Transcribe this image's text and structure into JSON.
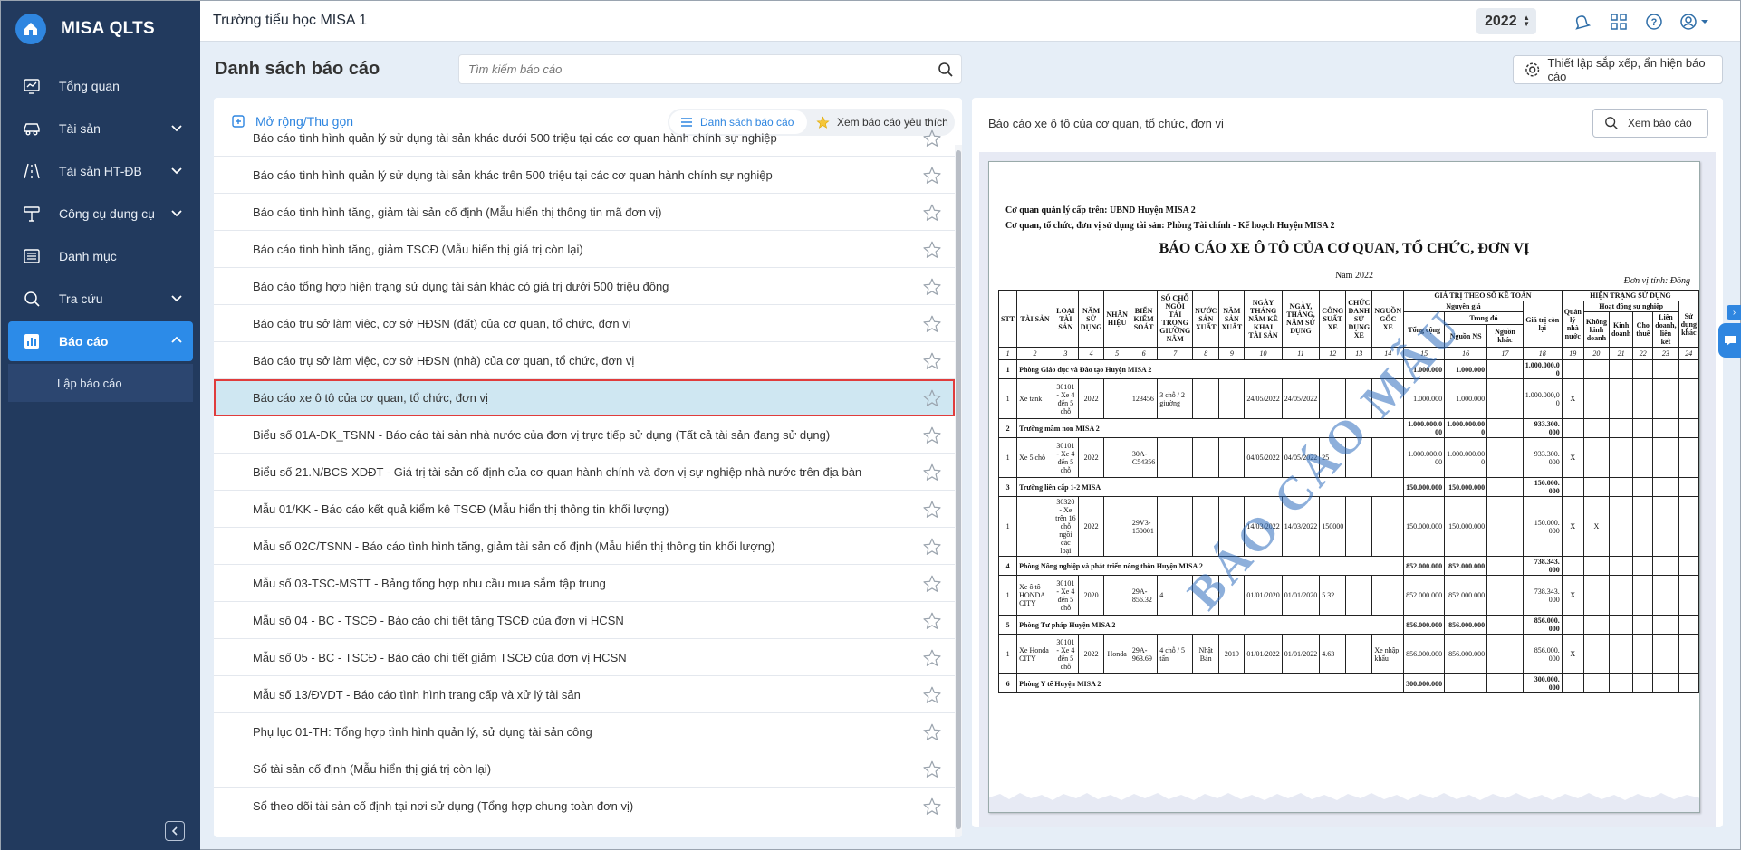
{
  "app": {
    "name": "MISA QLTS"
  },
  "sidebar": {
    "items": [
      {
        "label": "Tổng quan",
        "icon": "dashboard-icon",
        "expandable": false
      },
      {
        "label": "Tài sản",
        "icon": "car-icon",
        "expandable": true
      },
      {
        "label": "Tài sản HT-ĐB",
        "icon": "road-icon",
        "expandable": true
      },
      {
        "label": "Công cụ dụng cụ",
        "icon": "tools-icon",
        "expandable": true
      },
      {
        "label": "Danh mục",
        "icon": "list-icon",
        "expandable": false
      },
      {
        "label": "Tra cứu",
        "icon": "search-icon",
        "expandable": true
      },
      {
        "label": "Báo cáo",
        "icon": "bar-chart-icon",
        "expandable": true,
        "active": true
      }
    ],
    "subitem": "Lập báo cáo"
  },
  "topbar": {
    "school": "Trường tiểu học MISA 1",
    "year": "2022"
  },
  "header": {
    "title": "Danh sách báo cáo",
    "search_placeholder": "Tìm kiếm báo cáo",
    "settings_label": "Thiết lập sắp xếp, ẩn hiện báo cáo"
  },
  "left_panel": {
    "expand_label": "Mở rộng/Thu gọn",
    "tab_list": "Danh sách báo cáo",
    "tab_favorite": "Xem báo cáo yêu thích",
    "reports": [
      "Báo cáo tình hình quản lý sử dụng tài sản khác dưới 500 triệu tại các cơ quan hành chính sự nghiệp",
      "Báo cáo tình hình quản lý sử dụng tài sản khác trên 500 triệu tại các cơ quan hành chính sự nghiệp",
      "Báo cáo tình hình tăng, giảm tài sản cố định (Mẫu hiển thị thông tin mã đơn vị)",
      "Báo cáo tình hình tăng, giảm TSCĐ (Mẫu hiển thị giá trị còn lại)",
      "Báo cáo tổng hợp hiện trạng sử dụng tài sản khác có giá trị dưới 500 triệu đồng",
      "Báo cáo trụ sở làm việc, cơ sở HĐSN (đất) của cơ quan, tổ chức, đơn vị",
      "Báo cáo trụ sở làm việc, cơ sở HĐSN (nhà) của cơ quan, tổ chức, đơn vị",
      "Báo cáo xe ô tô của cơ quan, tổ chức, đơn vị",
      "Biểu số 01A-ĐK_TSNN - Báo cáo tài sản nhà nước của đơn vị trực tiếp sử dụng (Tất cả tài sản đang sử dụng)",
      "Biểu số 21.N/BCS-XDĐT - Giá trị tài sản cố định của cơ quan hành chính và đơn vị sự nghiệp nhà nước trên địa bàn",
      "Mẫu 01/KK - Báo cáo kết quả kiểm kê TSCĐ (Mẫu hiển thị thông tin khối lượng)",
      "Mẫu số 02C/TSNN - Báo cáo tình hình tăng, giảm tài sản cố định (Mẫu hiển thị thông tin khối lượng)",
      "Mẫu số 03-TSC-MSTT - Bảng tổng hợp nhu cầu mua sắm tập trung",
      "Mẫu số 04 - BC - TSCĐ - Báo cáo chi tiết tăng TSCĐ của đơn vị HCSN",
      "Mẫu số 05 - BC - TSCĐ - Báo cáo chi tiết giảm TSCĐ của đơn vị HCSN",
      "Mẫu số 13/ĐVDT - Báo cáo tình hình trang cấp và xử lý tài sản",
      "Phụ lục 01-TH: Tổng hợp tình hình quản lý, sử dụng tài sản công",
      "Sổ tài sản cố định (Mẫu hiển thị giá trị còn lại)",
      "Sổ theo dõi tài sản cố định tại nơi sử dụng (Tổng hợp chung toàn đơn vị)"
    ],
    "selected_index": 7
  },
  "right_panel": {
    "title": "Báo cáo xe ô tô của cơ quan, tổ chức, đơn vị",
    "view_label": "Xem báo cáo",
    "preview": {
      "line1": "Cơ quan quản lý cấp trên: UBND Huyện MISA 2",
      "line2": "Cơ quan, tổ chức, đơn vị sử dụng tài sản: Phòng Tài chính - Kế hoạch Huyện MISA 2",
      "title": "BÁO CÁO XE Ô TÔ CỦA CƠ QUAN, TỔ CHỨC, ĐƠN VỊ",
      "year": "Năm 2022",
      "unit": "Đơn vị tính: Đồng",
      "watermark": "BÁO CÁO MẪU",
      "headers": {
        "stt": "STT",
        "taisan": "TÀI SẢN",
        "loai": "LOẠI TÀI SẢN",
        "nam_sd": "NĂM SỬ DỤNG",
        "nhanhieu": "NHÃN HIỆU",
        "bienks": "BIỂN KIỂM SOÁT",
        "socho": "SỐ CHỖ NGỒI TẢI TRỌNG GIƯỜNG NẰM",
        "nuocsx": "NƯỚC SẢN XUẤT",
        "namsx": "NĂM SẢN XUẤT",
        "ngaykk": "NGÀY THÁNG NĂM KÊ KHAI TÀI SẢN",
        "ngaysd": "NGÀY, THÁNG, NĂM SỬ DỤNG",
        "congsuat": "CÔNG SUẤT XE",
        "chucdanh": "CHỨC DANH SỬ DỤNG XE",
        "nguongoc": "NGUỒN GỐC XE",
        "giatri": "GIÁ TRỊ THEO SỔ KẾ TOÁN",
        "nguyengia": "Nguyên giá",
        "tongcong": "Tổng cộng",
        "trongdo": "Trong đó",
        "nguonns": "Nguồn NS",
        "nguonkhac": "Nguồn khác",
        "gtcl": "Giá trị còn lại",
        "hientrang": "HIỆN TRẠNG SỬ DỤNG",
        "qlnn": "Quản lý nhà nước",
        "hdsn": "Hoạt động sự nghiệp",
        "kkd": "Không kinh doanh",
        "kd": "Kinh doanh",
        "chothue": "Cho thuê",
        "lienket": "Liên doanh, liên kết",
        "sdkhac": "Sử dụng khác"
      },
      "col_numbers": [
        "1",
        "2",
        "3",
        "4",
        "5",
        "6",
        "7",
        "8",
        "9",
        "10",
        "11",
        "12",
        "13",
        "14",
        "15",
        "16",
        "17",
        "18",
        "19",
        "20",
        "21",
        "22",
        "23",
        "24"
      ],
      "groups": [
        {
          "no": "1",
          "name": "Phòng Giáo dục và Đào tạo Huyện MISA 2",
          "total": "1.000.000",
          "ns": "1.000.000",
          "gtcl": "1.000.000,0 0",
          "rows": [
            {
              "no": "1",
              "name": "Xe tank",
              "type": "30101 - Xe 4 đến 5 chỗ",
              "year": "2022",
              "brand": "",
              "plate": "123456",
              "seats": "3 chỗ / 2 giường",
              "country": "",
              "made": "",
              "declared": "24/05/2022",
              "used": "24/05/2022",
              "power": "",
              "title": "",
              "origin": "",
              "total": "1.000.000",
              "ns": "1.000.000",
              "other": "",
              "gtcl": "1.000.000,0 0",
              "qlnn": "X",
              "kkd": ""
            }
          ]
        },
        {
          "no": "2",
          "name": "Trường mầm non MISA 2",
          "total": "1.000.000.0 00",
          "ns": "1.000.000.00 0",
          "gtcl": "933.300. 000",
          "rows": [
            {
              "no": "1",
              "name": "Xe 5 chỗ",
              "type": "30101 - Xe 4 đến 5 chỗ",
              "year": "2022",
              "brand": "",
              "plate": "30A-C54356",
              "seats": "",
              "country": "",
              "made": "",
              "declared": "04/05/2022",
              "used": "04/05/2022",
              "power": "25",
              "title": "",
              "origin": "",
              "total": "1.000.000.0 00",
              "ns": "1.000.000.00 0",
              "other": "",
              "gtcl": "933.300. 000",
              "qlnn": "X",
              "kkd": ""
            }
          ]
        },
        {
          "no": "3",
          "name": "Trường liên cấp 1-2 MISA",
          "total": "150.000.000",
          "ns": "150.000.000",
          "gtcl": "150.000. 000",
          "rows": [
            {
              "no": "1",
              "name": "",
              "type": "30320 - Xe trên 16 chỗ ngồi các loại",
              "year": "2022",
              "brand": "",
              "plate": "29V3-150001",
              "seats": "",
              "country": "",
              "made": "",
              "declared": "14/03/2022",
              "used": "14/03/2022",
              "power": "150000",
              "title": "",
              "origin": "",
              "total": "150.000.000",
              "ns": "150.000.000",
              "other": "",
              "gtcl": "150.000. 000",
              "qlnn": "X",
              "kkd": "X"
            }
          ]
        },
        {
          "no": "4",
          "name": "Phòng Nông nghiệp và phát triển nông thôn Huyện MISA 2",
          "total": "852.000.000",
          "ns": "852.000.000",
          "gtcl": "738.343. 000",
          "rows": [
            {
              "no": "1",
              "name": "Xe ô tô HONDA CITY",
              "type": "30101 - Xe 4 đến 5 chỗ",
              "year": "2020",
              "brand": "",
              "plate": "29A-856.32",
              "seats": "4",
              "country": "",
              "made": "",
              "declared": "01/01/2020",
              "used": "01/01/2020",
              "power": "5.32",
              "title": "",
              "origin": "",
              "total": "852.000.000",
              "ns": "852.000.000",
              "other": "",
              "gtcl": "738.343. 000",
              "qlnn": "X",
              "kkd": ""
            }
          ]
        },
        {
          "no": "5",
          "name": "Phòng Tư pháp Huyện MISA 2",
          "total": "856.000.000",
          "ns": "856.000.000",
          "gtcl": "856.000. 000",
          "rows": [
            {
              "no": "1",
              "name": "Xe Honda CITY",
              "type": "30101 - Xe 4 đến 5 chỗ",
              "year": "2022",
              "brand": "Honda",
              "plate": "29A-963.69",
              "seats": "4 chỗ / 5 tấn",
              "country": "Nhật Bản",
              "made": "2019",
              "declared": "01/01/2022",
              "used": "01/01/2022",
              "power": "4.63",
              "title": "",
              "origin": "Xe nhập khẩu",
              "total": "856.000.000",
              "ns": "856.000.000",
              "other": "",
              "gtcl": "856.000. 000",
              "qlnn": "X",
              "kkd": ""
            }
          ]
        },
        {
          "no": "6",
          "name": "Phòng Y tế Huyện MISA 2",
          "total": "300.000.000",
          "ns": "",
          "gtcl": "300.000. 000",
          "rows": []
        }
      ]
    }
  }
}
